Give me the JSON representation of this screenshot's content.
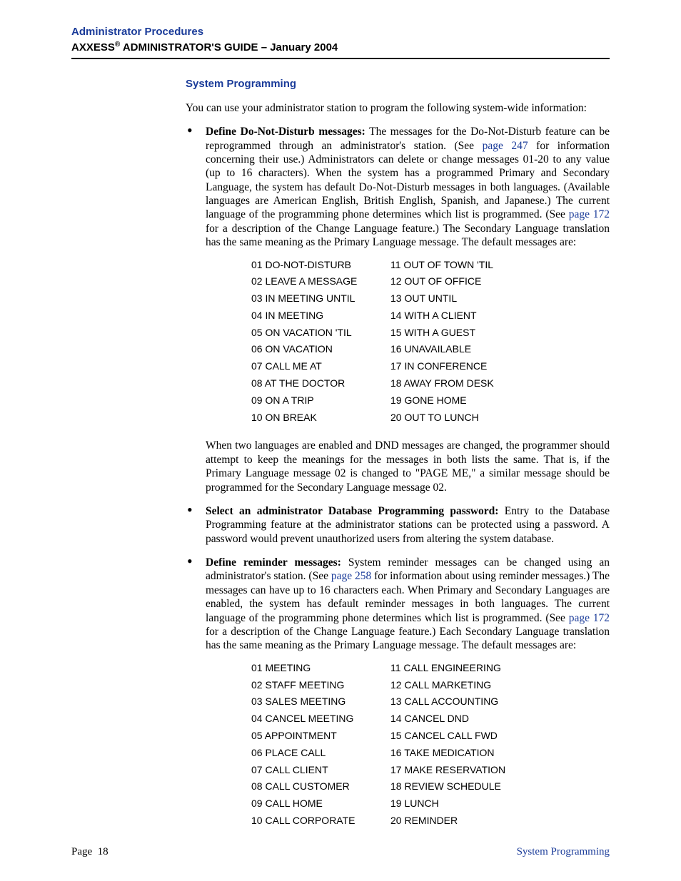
{
  "header": {
    "title": "Administrator Procedures",
    "product": "AXXESS",
    "reg": "®",
    "sub": " ADMINISTRATOR'S GUIDE – January 2004"
  },
  "section_heading": "System Programming",
  "intro": "You can use your administrator station to program the following system-wide information:",
  "b1": {
    "lead": "Define Do-Not-Disturb messages:",
    "t1": " The messages for the Do-Not-Disturb feature can be reprogrammed through an administrator's station. (See ",
    "l1": "page 247",
    "t2": " for information concerning their use.) Administrators can delete or change messages 01-20 to any value (up to 16 characters). When the system has a programmed Primary and Secondary Language, the system has default Do-Not-Disturb messages in both languages. (Available languages are American English, British English, Spanish, and Japanese.) The current language of the programming phone determines which list is programmed. (See ",
    "l2": "page 172",
    "t3": " for a description of the Change Language feature.) The Secondary Language translation has the same meaning as the Primary Language message. The default messages are:"
  },
  "dnd": [
    {
      "a": "01 DO-NOT-DISTURB",
      "b": "11 OUT OF TOWN 'TIL"
    },
    {
      "a": "02 LEAVE A MESSAGE",
      "b": "12 OUT OF OFFICE"
    },
    {
      "a": "03 IN MEETING UNTIL",
      "b": "13 OUT UNTIL"
    },
    {
      "a": "04 IN MEETING",
      "b": "14 WITH A CLIENT"
    },
    {
      "a": "05 ON VACATION 'TIL",
      "b": "15 WITH A GUEST"
    },
    {
      "a": "06 ON VACATION",
      "b": "16 UNAVAILABLE"
    },
    {
      "a": "07 CALL ME AT",
      "b": "17 IN CONFERENCE"
    },
    {
      "a": "08 AT THE DOCTOR",
      "b": "18 AWAY FROM DESK"
    },
    {
      "a": "09 ON A TRIP",
      "b": "19 GONE HOME"
    },
    {
      "a": "10 ON BREAK",
      "b": "20 OUT TO LUNCH"
    }
  ],
  "b1_after": "When two languages are enabled and DND messages are changed, the programmer should attempt to keep the meanings for the messages in both lists the same. That is, if the Primary Language message 02 is changed to \"PAGE ME,\" a similar message should be programmed for the Secondary Language message 02.",
  "b2": {
    "lead": "Select an administrator Database Programming password:",
    "t1": " Entry to the Database Programming feature at the administrator stations can be protected using a password. A password would prevent unauthorized users from altering the system database."
  },
  "b3": {
    "lead": "Define reminder messages:",
    "t1": " System reminder messages can be changed using an administrator's station. (See ",
    "l1": "page 258",
    "t2": " for information about using reminder messages.) The messages can have up to 16 characters each. When Primary and Secondary Languages are enabled, the system has default reminder messages in both languages. The current language of the programming phone determines which list is programmed. (See ",
    "l2": "page 172",
    "t3": " for a description of the Change Language feature.) Each Secondary Language translation has the same meaning as the Primary Language message. The default messages are:"
  },
  "rem": [
    {
      "a": "01 MEETING",
      "b": "11 CALL ENGINEERING"
    },
    {
      "a": "02 STAFF MEETING",
      "b": "12 CALL MARKETING"
    },
    {
      "a": "03 SALES MEETING",
      "b": "13 CALL ACCOUNTING"
    },
    {
      "a": "04 CANCEL MEETING",
      "b": "14 CANCEL DND"
    },
    {
      "a": "05 APPOINTMENT",
      "b": "15 CANCEL CALL FWD"
    },
    {
      "a": "06 PLACE CALL",
      "b": "16 TAKE MEDICATION"
    },
    {
      "a": "07 CALL CLIENT",
      "b": "17 MAKE RESERVATION"
    },
    {
      "a": "08 CALL CUSTOMER",
      "b": "18 REVIEW SCHEDULE"
    },
    {
      "a": "09 CALL HOME",
      "b": "19 LUNCH"
    },
    {
      "a": "10 CALL CORPORATE",
      "b": "20 REMINDER"
    }
  ],
  "footer": {
    "left_label": "Page",
    "page_num": "18",
    "right": "System Programming"
  }
}
